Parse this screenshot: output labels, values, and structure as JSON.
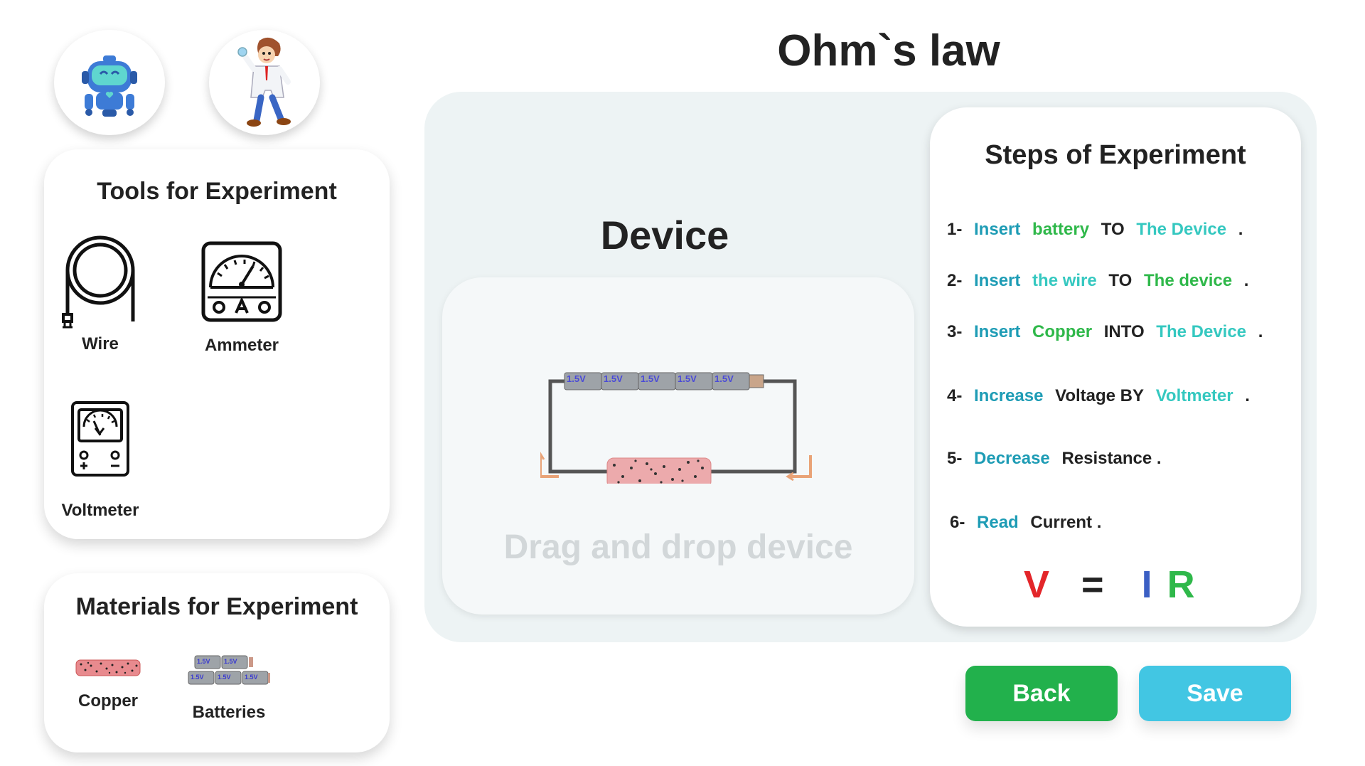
{
  "header": {
    "title": "Ohm`s law"
  },
  "avatars": [
    {
      "name": "robot-icon"
    },
    {
      "name": "scientist-icon"
    }
  ],
  "tools": {
    "title": "Tools for Experiment",
    "items": [
      {
        "label": "Wire",
        "icon": "wire-icon"
      },
      {
        "label": "Ammeter",
        "icon": "ammeter-icon"
      },
      {
        "label": "Voltmeter",
        "icon": "voltmeter-icon"
      }
    ]
  },
  "materials": {
    "title": "Materials for Experiment",
    "items": [
      {
        "label": "Copper",
        "icon": "copper-rod-icon"
      },
      {
        "label": "Batteries",
        "icon": "batteries-icon"
      }
    ],
    "battery_label": "1.5V"
  },
  "device": {
    "title": "Device",
    "placeholder": "Drag and drop device",
    "battery_label": "1.5V"
  },
  "steps": {
    "title": "Steps of Experiment",
    "items": [
      {
        "num": "1-",
        "parts": [
          "Insert",
          "battery",
          "TO",
          "The Device",
          "."
        ]
      },
      {
        "num": "2-",
        "parts": [
          "Insert",
          "the wire",
          "TO",
          "The device",
          "."
        ]
      },
      {
        "num": "3-",
        "parts": [
          "Insert",
          "Copper",
          "INTO",
          "The Device",
          "."
        ]
      },
      {
        "num": "4-",
        "parts": [
          "Increase",
          "Voltage BY",
          "Voltmeter",
          "."
        ]
      },
      {
        "num": "5-",
        "parts": [
          "Decrease",
          "Resistance ."
        ]
      },
      {
        "num": "6-",
        "parts": [
          "Read",
          "Current ."
        ]
      }
    ],
    "formula": {
      "v": "V",
      "eq": "=",
      "i": "I",
      "r": "R"
    }
  },
  "buttons": {
    "back": "Back",
    "save": "Save"
  },
  "colors": {
    "back": "#22b14c",
    "save": "#42c6e3",
    "formula_v": "#e3262a",
    "formula_i": "#3b5fc4",
    "formula_r": "#2fb84a",
    "placeholder": "#d2d7d9"
  }
}
